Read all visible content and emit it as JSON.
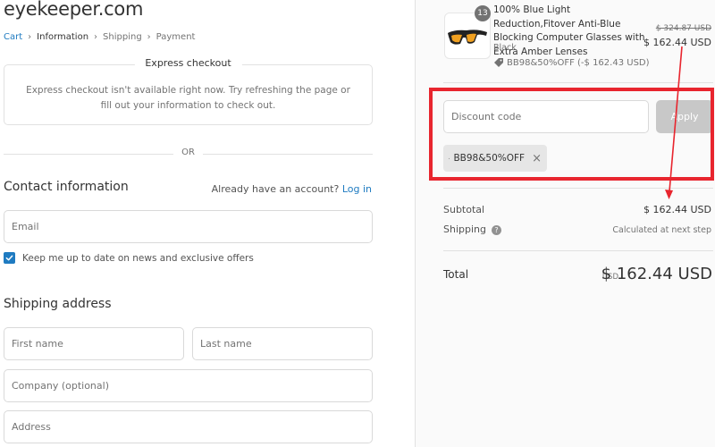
{
  "header": {
    "logo": "eyekeeper.com",
    "breadcrumb": [
      {
        "label": "Cart"
      },
      {
        "label": "Information"
      },
      {
        "label": "Shipping"
      },
      {
        "label": "Payment"
      }
    ],
    "separator": "›"
  },
  "express": {
    "title": "Express checkout",
    "message": "Express checkout isn't available right now. Try refreshing the page or fill out your information to check out.",
    "or_label": "OR"
  },
  "contact": {
    "title": "Contact information",
    "account_prompt": "Already have an account?",
    "login_link": "Log in",
    "email_placeholder": "Email",
    "email_value": "",
    "newsletter_label": "Keep me up to date on news and exclusive offers",
    "newsletter_checked": true
  },
  "shipping": {
    "title": "Shipping address",
    "first_name_placeholder": "First name",
    "last_name_placeholder": "Last name",
    "company_placeholder": "Company (optional)",
    "address_placeholder": "Address"
  },
  "order": {
    "product": {
      "quantity": "13",
      "title": "100% Blue Light Reduction,Fitover Anti-Blue Blocking Computer Glasses with Extra Amber Lenses",
      "variant": "Black",
      "discount_line": "BB98&50%OFF (-$ 162.43 USD)",
      "original_price": "$ 324.87 USD",
      "price": "$ 162.44 USD"
    },
    "discount": {
      "placeholder": "Discount code",
      "value": "",
      "apply_label": "Apply",
      "applied_code": "BB98&50%OFF",
      "remove_icon": "×"
    },
    "summary": {
      "subtotal_label": "Subtotal",
      "subtotal_value": "$ 162.44 USD",
      "shipping_label": "Shipping",
      "shipping_value": "Calculated at next step",
      "help_icon": "?",
      "total_label": "Total",
      "total_currency": "USD",
      "total_value": "$ 162.44 USD"
    }
  },
  "annotation": {
    "highlight_color": "#e8252e",
    "arrow_color": "#e8252e"
  },
  "colors": {
    "link": "#1f7bc1",
    "checkbox": "#1f7bc1",
    "apply_disabled": "#c8c8c8",
    "sidebar_bg": "#fafafa"
  }
}
